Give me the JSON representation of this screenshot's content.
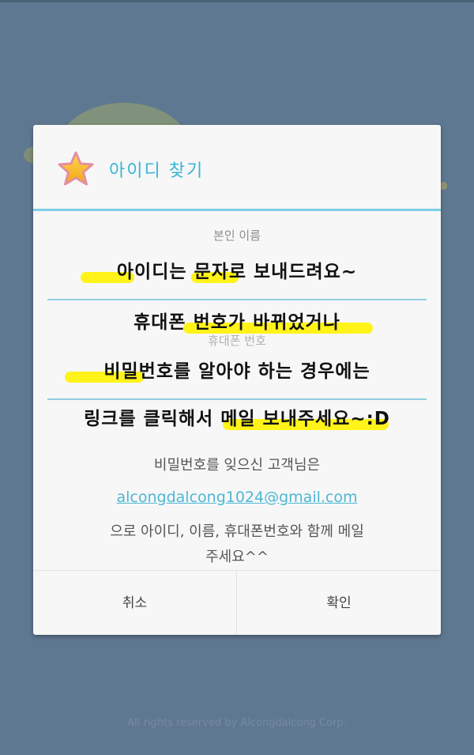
{
  "dialog": {
    "title": "아이디 찾기",
    "name_label": "본인 이름",
    "phone_label": "휴대폰 번호",
    "overlay_lines": [
      "아이디는 문자로 보내드려요~",
      "휴대폰 번호가 바뀌었거나",
      "비밀번호를 알아야 하는 경우에는",
      "링크를 클릭해서 메일 보내주세요~:D"
    ],
    "info_line1": "비밀번호를 잊으신 고객님은",
    "email": "alcongdalcong1024@gmail.com",
    "info_line2": "으로 아이디, 이름, 휴대폰번호와 함께 메일",
    "info_line3": "주세요^^",
    "cancel_label": "취소",
    "ok_label": "확인"
  },
  "footer": "All rights reserved by Alcongdalcong Corp.",
  "colors": {
    "background": "#5f7891",
    "accent": "#39b4d6",
    "highlight": "#fff200"
  },
  "icons": {
    "title_icon": "star-icon"
  }
}
